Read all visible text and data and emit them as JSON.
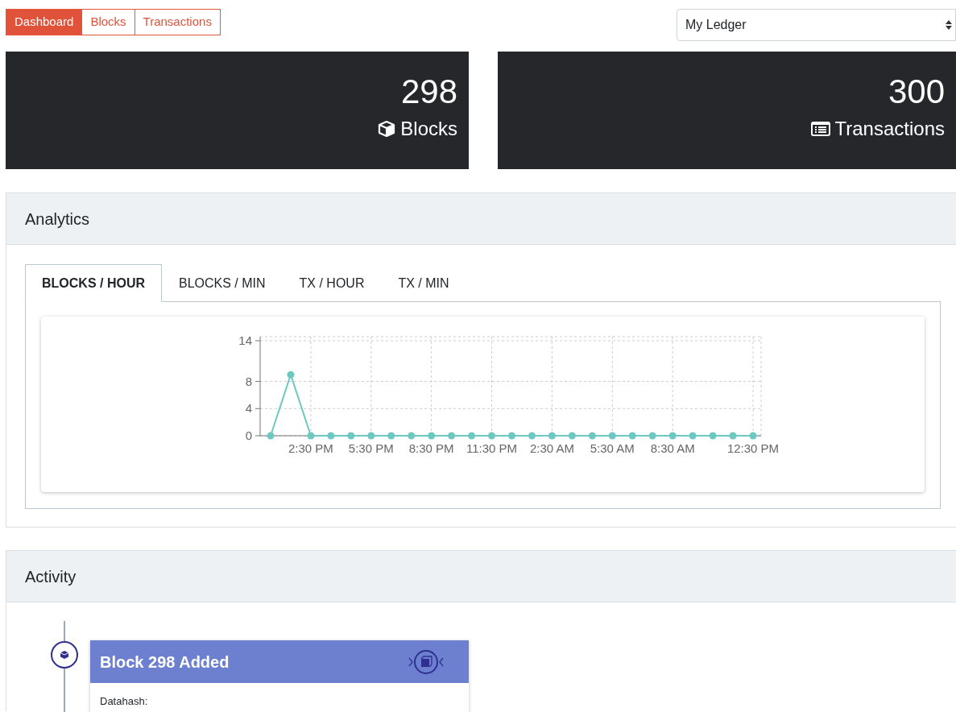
{
  "nav_tabs": [
    {
      "label": "Dashboard",
      "selected": true
    },
    {
      "label": "Blocks",
      "selected": false
    },
    {
      "label": "Transactions",
      "selected": false
    }
  ],
  "ledger_select": {
    "value": "My Ledger"
  },
  "stats": [
    {
      "kind": "blocks",
      "value": "298",
      "label": "Blocks"
    },
    {
      "kind": "transactions",
      "value": "300",
      "label": "Transactions"
    }
  ],
  "analytics": {
    "title": "Analytics",
    "tabs": [
      {
        "label": "BLOCKS / HOUR",
        "selected": true
      },
      {
        "label": "BLOCKS / MIN",
        "selected": false
      },
      {
        "label": "TX / HOUR",
        "selected": false
      },
      {
        "label": "TX / MIN",
        "selected": false
      }
    ],
    "chart_data": {
      "type": "line",
      "categories": [
        null,
        null,
        "2:30 PM",
        null,
        null,
        "5:30 PM",
        null,
        null,
        "8:30 PM",
        null,
        null,
        "11:30 PM",
        null,
        null,
        "2:30 AM",
        null,
        null,
        "5:30 AM",
        null,
        null,
        "8:30 AM",
        null,
        null,
        null,
        "12:30 PM"
      ],
      "grid": true,
      "series": [
        {
          "color": "#6cc8c0",
          "marker": true,
          "values": [
            0,
            9,
            0,
            0,
            0,
            0,
            0,
            0,
            0,
            0,
            0,
            0,
            0,
            0,
            0,
            0,
            0,
            0,
            0,
            0,
            0,
            0,
            0,
            0,
            0
          ]
        }
      ],
      "ylim": [
        0,
        14
      ],
      "yticks": [
        0,
        4,
        8,
        14
      ]
    }
  },
  "activity": {
    "title": "Activity",
    "items": [
      {
        "title": "Block 298 Added",
        "field_label": "Datahash:"
      }
    ]
  }
}
